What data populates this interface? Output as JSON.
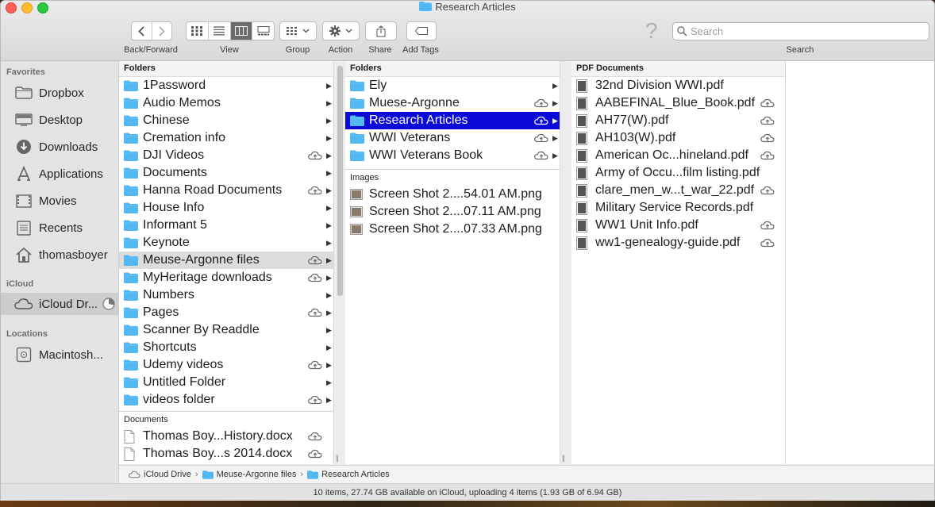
{
  "window": {
    "title": "Research Articles"
  },
  "toolbar": {
    "labels": {
      "back_forward": "Back/Forward",
      "view": "View",
      "group": "Group",
      "action": "Action",
      "share": "Share",
      "add_tags": "Add Tags",
      "search": "Search"
    },
    "search_placeholder": "Search"
  },
  "sidebar": {
    "sections": {
      "favorites": "Favorites",
      "icloud": "iCloud",
      "locations": "Locations"
    },
    "favorites": [
      {
        "label": "Dropbox",
        "icon": "dropbox-folder-icon"
      },
      {
        "label": "Desktop",
        "icon": "desktop-icon"
      },
      {
        "label": "Downloads",
        "icon": "downloads-icon"
      },
      {
        "label": "Applications",
        "icon": "applications-icon"
      },
      {
        "label": "Movies",
        "icon": "movies-icon"
      },
      {
        "label": "Recents",
        "icon": "recents-icon"
      },
      {
        "label": "thomasboyer",
        "icon": "home-icon"
      }
    ],
    "icloud": [
      {
        "label": "iCloud Dr...",
        "icon": "icloud-icon",
        "selected": true
      }
    ],
    "locations": [
      {
        "label": "Macintosh...",
        "icon": "hard-drive-icon"
      }
    ]
  },
  "col1": {
    "header": "Folders",
    "folders": [
      {
        "name": "1Password",
        "cloud": false
      },
      {
        "name": "Audio Memos",
        "cloud": false
      },
      {
        "name": "Chinese",
        "cloud": false
      },
      {
        "name": "Cremation info",
        "cloud": false
      },
      {
        "name": "DJI Videos",
        "cloud": true
      },
      {
        "name": "Documents",
        "cloud": false
      },
      {
        "name": "Hanna Road Documents",
        "cloud": true
      },
      {
        "name": "House Info",
        "cloud": false
      },
      {
        "name": "Informant 5",
        "cloud": false
      },
      {
        "name": "Keynote",
        "cloud": false
      },
      {
        "name": "Meuse-Argonne files",
        "cloud": true,
        "highlight": true
      },
      {
        "name": "MyHeritage downloads",
        "cloud": true
      },
      {
        "name": "Numbers",
        "cloud": false
      },
      {
        "name": "Pages",
        "cloud": true
      },
      {
        "name": "Scanner By Readdle",
        "cloud": false
      },
      {
        "name": "Shortcuts",
        "cloud": false
      },
      {
        "name": "Udemy videos",
        "cloud": true
      },
      {
        "name": "Untitled Folder",
        "cloud": false
      },
      {
        "name": "videos folder",
        "cloud": true
      }
    ],
    "documents_header": "Documents",
    "documents": [
      {
        "name": "Thomas Boy...History.docx",
        "cloud": true
      },
      {
        "name": "Thomas Boy...s 2014.docx",
        "cloud": true
      }
    ]
  },
  "col2": {
    "header": "Folders",
    "folders": [
      {
        "name": "Ely",
        "cloud": false
      },
      {
        "name": "Muese-Argonne",
        "cloud": true
      },
      {
        "name": "Research Articles",
        "cloud": true,
        "selected": true
      },
      {
        "name": "WWI Veterans",
        "cloud": true
      },
      {
        "name": "WWI Veterans Book",
        "cloud": true
      }
    ],
    "images_header": "Images",
    "images": [
      {
        "name": "Screen Shot 2....54.01 AM.png"
      },
      {
        "name": "Screen Shot 2....07.11 AM.png"
      },
      {
        "name": "Screen Shot 2....07.33 AM.png"
      }
    ]
  },
  "col3": {
    "header": "PDF Documents",
    "files": [
      {
        "name": "32nd Division WWI.pdf",
        "cloud": false
      },
      {
        "name": "AABEFINAL_Blue_Book.pdf",
        "cloud": true
      },
      {
        "name": "AH77(W).pdf",
        "cloud": true
      },
      {
        "name": "AH103(W).pdf",
        "cloud": true
      },
      {
        "name": "American Oc...hineland.pdf",
        "cloud": true
      },
      {
        "name": "Army of Occu...film listing.pdf",
        "cloud": false
      },
      {
        "name": "clare_men_w...t_war_22.pdf",
        "cloud": true
      },
      {
        "name": "Military Service Records.pdf",
        "cloud": false
      },
      {
        "name": "WW1 Unit Info.pdf",
        "cloud": true
      },
      {
        "name": "ww1-genealogy-guide.pdf",
        "cloud": true
      }
    ]
  },
  "pathbar": {
    "items": [
      "iCloud Drive",
      "Meuse-Argonne files",
      "Research Articles"
    ]
  },
  "status": {
    "text": "10 items, 27.74 GB available on iCloud, uploading 4 items (1.93 GB of 6.94 GB)"
  },
  "colors": {
    "selection": "#0b0ad6",
    "folder": "#52b8f2"
  }
}
